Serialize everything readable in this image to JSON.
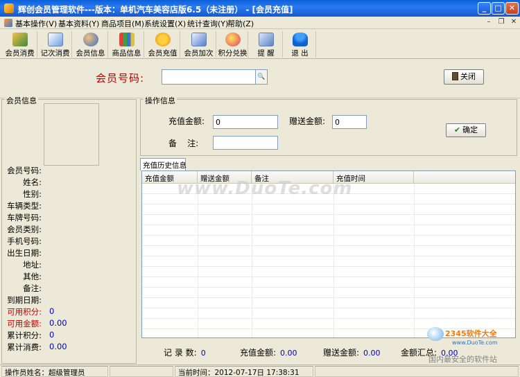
{
  "window": {
    "title": "辉创会员管理软件---版本：单机汽车美容店版6.5（未注册） - [会员充值]",
    "minimize": "_",
    "maximize": "□",
    "close": "✕"
  },
  "menu": {
    "items": [
      "基本操作(V)",
      "基本资料(Y)",
      "商品项目(M)",
      "系统设置(X)",
      "统计查询(Y)",
      "帮助(Z)"
    ],
    "mdi_min": "–",
    "mdi_restore": "❐",
    "mdi_close": "✕"
  },
  "toolbar": {
    "items": [
      "会员消费",
      "记次消费",
      "会员信息",
      "商品信息",
      "会员充值",
      "会员加次",
      "积分兑换",
      "提 醒",
      "退 出"
    ]
  },
  "search": {
    "label": "会员号码:",
    "value": "",
    "button_glyph": "🔍",
    "close_label": "关闭"
  },
  "member_info": {
    "title": "会员信息",
    "fields": [
      {
        "label": "会员号码:",
        "value": ""
      },
      {
        "label": "姓名:",
        "value": ""
      },
      {
        "label": "性别:",
        "value": ""
      },
      {
        "label": "车辆类型:",
        "value": ""
      },
      {
        "label": "车牌号码:",
        "value": ""
      },
      {
        "label": "会员类别:",
        "value": ""
      },
      {
        "label": "手机号码:",
        "value": ""
      },
      {
        "label": "出生日期:",
        "value": ""
      },
      {
        "label": "地址:",
        "value": ""
      },
      {
        "label": "其他:",
        "value": ""
      },
      {
        "label": "备注:",
        "value": ""
      },
      {
        "label": "到期日期:",
        "value": ""
      },
      {
        "label": "可用积分:",
        "value": "0"
      },
      {
        "label": "可用金额:",
        "value": "0.00"
      },
      {
        "label": "累计积分:",
        "value": "0"
      },
      {
        "label": "累计消费:",
        "value": "0.00"
      }
    ]
  },
  "operation": {
    "title": "操作信息",
    "recharge_label": "充值金额:",
    "recharge_value": "0",
    "bonus_label": "赠送金额:",
    "bonus_value": "0",
    "remark_label": "备    注:",
    "remark_value": "",
    "confirm_label": "确定"
  },
  "history": {
    "tab": "充值历史信息",
    "columns": [
      "充值金额",
      "赠送金额",
      "备注",
      "充值时间"
    ]
  },
  "summary": {
    "count_label": "记 录 数:",
    "count_value": "0",
    "recharge_label": "充值金额:",
    "recharge_value": "0.00",
    "bonus_label": "赠送金额:",
    "bonus_value": "0.00",
    "total_label": "金额汇总:",
    "total_value": "0.00"
  },
  "status": {
    "operator": "操作员姓名：超级管理员",
    "time": "当前时间：2012-07-17日 17:38:31"
  },
  "watermark": {
    "text": "www.DuoTe.com",
    "corner_brand": "2345软件大全",
    "corner_url": "www.DuoTe.com",
    "corner_slogan": "国内最安全的软件站"
  },
  "colors": {
    "title_blue": "#1658d0",
    "label_red": "#c00000",
    "value_blue": "#0000c0",
    "window_face": "#ece9d8"
  }
}
